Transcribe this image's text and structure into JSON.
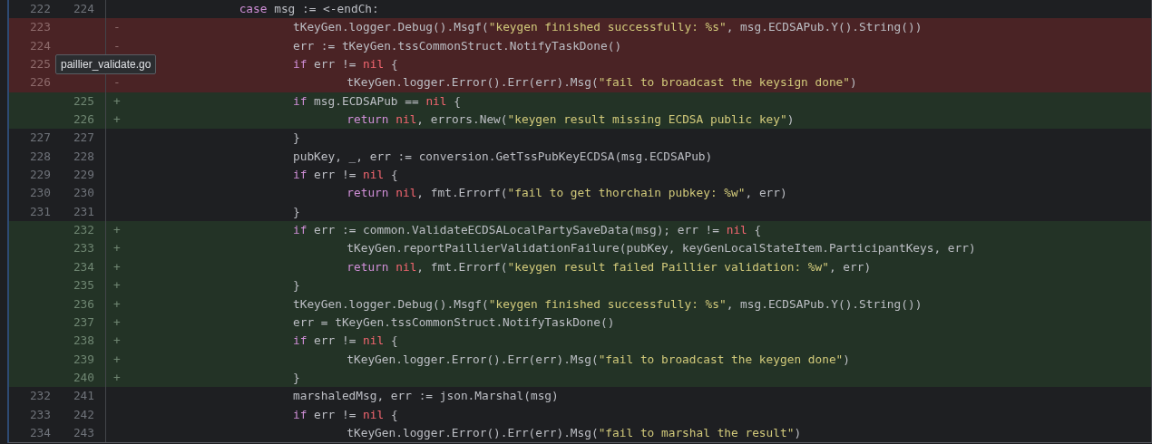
{
  "lines": [
    {
      "old": "222",
      "new": "224",
      "kind": "context",
      "code": [
        {
          "kind": "keyword",
          "text": "\t\tcase"
        },
        {
          "kind": "plain",
          "text": " msg := <-endCh:"
        }
      ]
    },
    {
      "old": "223",
      "kind": "removed",
      "sign": "-",
      "code": [
        {
          "kind": "plain",
          "text": "\t\t\ttKeyGen.logger.Debug().Msgf("
        },
        {
          "kind": "string",
          "text": "\"keygen finished successfully: %s\""
        },
        {
          "kind": "plain",
          "text": ", msg.ECDSAPub.Y().String())"
        }
      ]
    },
    {
      "old": "224",
      "kind": "removed",
      "sign": "-",
      "code": [
        {
          "kind": "plain",
          "text": "\t\t\terr := tKeyGen.tssCommonStruct.NotifyTaskDone()"
        }
      ]
    },
    {
      "old": "225",
      "kind": "removed",
      "code": [
        {
          "kind": "keyword",
          "text": "\t\t\tif"
        },
        {
          "kind": "plain",
          "text": " err != "
        },
        {
          "kind": "constant",
          "text": "nil"
        },
        {
          "kind": "plain",
          "text": " {"
        }
      ]
    },
    {
      "old": "226",
      "kind": "removed",
      "sign": "-",
      "code": [
        {
          "kind": "plain",
          "text": "\t\t\t\ttKeyGen.logger.Error().Err(err).Msg("
        },
        {
          "kind": "string",
          "text": "\"fail to broadcast the keysign done\""
        },
        {
          "kind": "plain",
          "text": ")"
        }
      ]
    },
    {
      "new": "225",
      "kind": "added",
      "sign": "+",
      "code": [
        {
          "kind": "keyword",
          "text": "\t\t\tif"
        },
        {
          "kind": "plain",
          "text": " msg.ECDSAPub == "
        },
        {
          "kind": "constant",
          "text": "nil"
        },
        {
          "kind": "plain",
          "text": " {"
        }
      ]
    },
    {
      "new": "226",
      "kind": "added",
      "sign": "+",
      "code": [
        {
          "kind": "keyword",
          "text": "\t\t\t\treturn"
        },
        {
          "kind": "constant",
          "text": " nil"
        },
        {
          "kind": "plain",
          "text": ", errors.New("
        },
        {
          "kind": "string",
          "text": "\"keygen result missing ECDSA public key\""
        },
        {
          "kind": "plain",
          "text": ")"
        }
      ]
    },
    {
      "old": "227",
      "new": "227",
      "kind": "context",
      "code": [
        {
          "kind": "plain",
          "text": "\t\t\t}"
        }
      ]
    },
    {
      "old": "228",
      "new": "228",
      "kind": "context",
      "code": [
        {
          "kind": "plain",
          "text": "\t\t\tpubKey, _, err := conversion.GetTssPubKeyECDSA(msg.ECDSAPub)"
        }
      ]
    },
    {
      "old": "229",
      "new": "229",
      "kind": "context",
      "code": [
        {
          "kind": "keyword",
          "text": "\t\t\tif"
        },
        {
          "kind": "plain",
          "text": " err != "
        },
        {
          "kind": "constant",
          "text": "nil"
        },
        {
          "kind": "plain",
          "text": " {"
        }
      ]
    },
    {
      "old": "230",
      "new": "230",
      "kind": "context",
      "code": [
        {
          "kind": "keyword",
          "text": "\t\t\t\treturn"
        },
        {
          "kind": "constant",
          "text": " nil"
        },
        {
          "kind": "plain",
          "text": ", fmt.Errorf("
        },
        {
          "kind": "string",
          "text": "\"fail to get thorchain pubkey: %w\""
        },
        {
          "kind": "plain",
          "text": ", err)"
        }
      ]
    },
    {
      "old": "231",
      "new": "231",
      "kind": "context",
      "code": [
        {
          "kind": "plain",
          "text": "\t\t\t}"
        }
      ]
    },
    {
      "new": "232",
      "kind": "added",
      "sign": "+",
      "code": [
        {
          "kind": "keyword",
          "text": "\t\t\tif"
        },
        {
          "kind": "plain",
          "text": " err := common.ValidateECDSALocalPartySaveData(msg); err != "
        },
        {
          "kind": "constant",
          "text": "nil"
        },
        {
          "kind": "plain",
          "text": " {"
        }
      ]
    },
    {
      "new": "233",
      "kind": "added",
      "sign": "+",
      "code": [
        {
          "kind": "plain",
          "text": "\t\t\t\ttKeyGen.reportPaillierValidationFailure(pubKey, keyGenLocalStateItem.ParticipantKeys, err)"
        }
      ]
    },
    {
      "new": "234",
      "kind": "added",
      "sign": "+",
      "code": [
        {
          "kind": "keyword",
          "text": "\t\t\t\treturn"
        },
        {
          "kind": "constant",
          "text": " nil"
        },
        {
          "kind": "plain",
          "text": ", fmt.Errorf("
        },
        {
          "kind": "string",
          "text": "\"keygen result failed Paillier validation: %w\""
        },
        {
          "kind": "plain",
          "text": ", err)"
        }
      ]
    },
    {
      "new": "235",
      "kind": "added",
      "sign": "+",
      "code": [
        {
          "kind": "plain",
          "text": "\t\t\t}"
        }
      ]
    },
    {
      "new": "236",
      "kind": "added",
      "sign": "+",
      "code": [
        {
          "kind": "plain",
          "text": "\t\t\ttKeyGen.logger.Debug().Msgf("
        },
        {
          "kind": "string",
          "text": "\"keygen finished successfully: %s\""
        },
        {
          "kind": "plain",
          "text": ", msg.ECDSAPub.Y().String())"
        }
      ]
    },
    {
      "new": "237",
      "kind": "added",
      "sign": "+",
      "code": [
        {
          "kind": "plain",
          "text": "\t\t\terr = tKeyGen.tssCommonStruct.NotifyTaskDone()"
        }
      ]
    },
    {
      "new": "238",
      "kind": "added",
      "sign": "+",
      "code": [
        {
          "kind": "keyword",
          "text": "\t\t\tif"
        },
        {
          "kind": "plain",
          "text": " err != "
        },
        {
          "kind": "constant",
          "text": "nil"
        },
        {
          "kind": "plain",
          "text": " {"
        }
      ]
    },
    {
      "new": "239",
      "kind": "added",
      "sign": "+",
      "code": [
        {
          "kind": "plain",
          "text": "\t\t\t\ttKeyGen.logger.Error().Err(err).Msg("
        },
        {
          "kind": "string",
          "text": "\"fail to broadcast the keygen done\""
        },
        {
          "kind": "plain",
          "text": ")"
        }
      ]
    },
    {
      "new": "240",
      "kind": "added",
      "sign": "+",
      "code": [
        {
          "kind": "plain",
          "text": "\t\t\t}"
        }
      ]
    },
    {
      "old": "232",
      "new": "241",
      "kind": "context",
      "code": [
        {
          "kind": "plain",
          "text": "\t\t\tmarshaledMsg, err := json.Marshal(msg)"
        }
      ]
    },
    {
      "old": "233",
      "new": "242",
      "kind": "context",
      "code": [
        {
          "kind": "keyword",
          "text": "\t\t\tif"
        },
        {
          "kind": "plain",
          "text": " err != "
        },
        {
          "kind": "constant",
          "text": "nil"
        },
        {
          "kind": "plain",
          "text": " {"
        }
      ]
    },
    {
      "old": "234",
      "new": "243",
      "kind": "context",
      "code": [
        {
          "kind": "plain",
          "text": "\t\t\t\ttKeyGen.logger.Error().Err(err).Msg("
        },
        {
          "kind": "string",
          "text": "\"fail to marshal the result\""
        },
        {
          "kind": "plain",
          "text": ")"
        }
      ]
    }
  ],
  "tooltip": {
    "text": "paillier_validate.go"
  }
}
